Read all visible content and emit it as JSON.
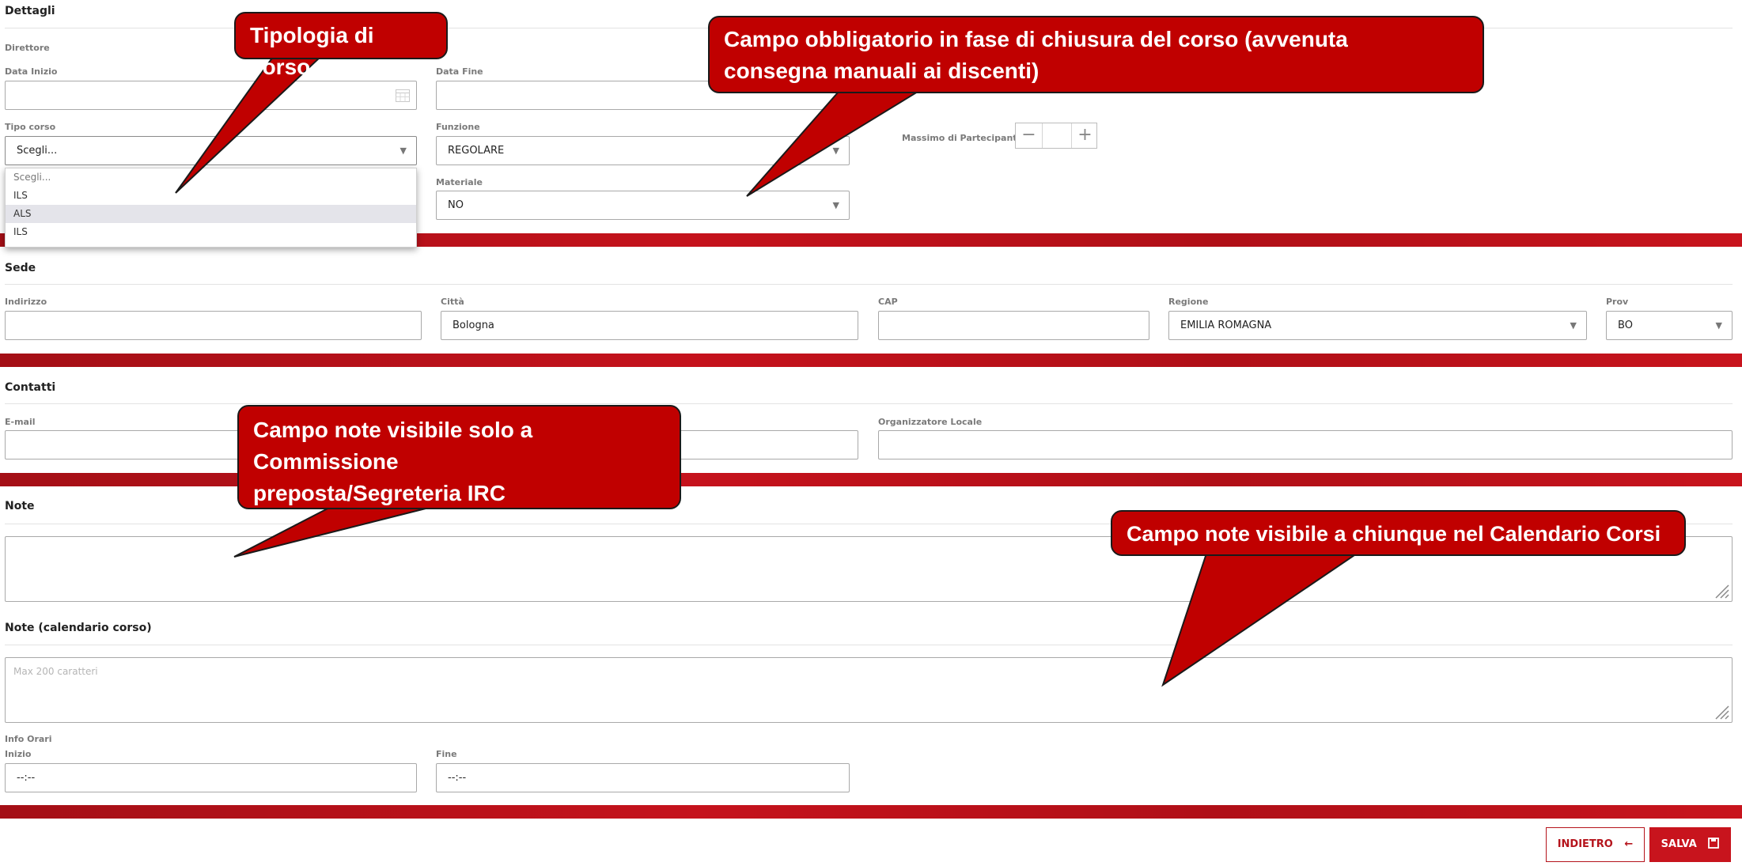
{
  "sections": {
    "dettagli": "Dettagli",
    "sede": "Sede",
    "contatti": "Contatti",
    "note": "Note",
    "note_calendario": "Note (calendario corso)"
  },
  "dettagli": {
    "direttore_label": "Direttore",
    "data_inizio_label": "Data Inizio",
    "data_fine_label": "Data Fine",
    "tipo_corso_label": "Tipo corso",
    "tipo_corso_value": "Scegli...",
    "funzione_label": "Funzione",
    "funzione_value": "REGOLARE",
    "max_partecipanti_label": "Massimo di Partecipanti",
    "materiale_label": "Materiale",
    "materiale_value": "NO",
    "tipo_corso_options": [
      "Scegli...",
      "ILS",
      "ALS",
      "ILS"
    ]
  },
  "sede": {
    "indirizzo_label": "Indirizzo",
    "citta_label": "Città",
    "citta_value": "Bologna",
    "cap_label": "CAP",
    "regione_label": "Regione",
    "regione_value": "EMILIA ROMAGNA",
    "prov_label": "Prov",
    "prov_value": "BO"
  },
  "contatti": {
    "email_label": "E-mail",
    "organizzatore_label": "Organizzatore Locale"
  },
  "note_calendario": {
    "placeholder": "Max 200 caratteri"
  },
  "orari": {
    "info_label": "Info Orari",
    "inizio_label": "Inizio",
    "inizio_value": "--:--",
    "fine_label": "Fine",
    "fine_value": "--:--"
  },
  "stepper": {
    "minus": "−",
    "plus": "+"
  },
  "buttons": {
    "indietro": "INDIETRO",
    "salva": "SALVA"
  },
  "callouts": {
    "tipologia": "Tipologia di corso",
    "obbligatorio_line1": "Campo obbligatorio in fase di chiusura del corso (avvenuta",
    "obbligatorio_line2": "consegna manuali ai discenti)",
    "note_commissione_line1": "Campo note visibile solo a Commissione",
    "note_commissione_line2": "preposta/Segreteria IRC",
    "note_calendario": "Campo note visibile a chiunque nel Calendario Corsi"
  },
  "colors": {
    "accent": "#c8141d",
    "callout": "#c00000",
    "band": "#b00f17"
  }
}
